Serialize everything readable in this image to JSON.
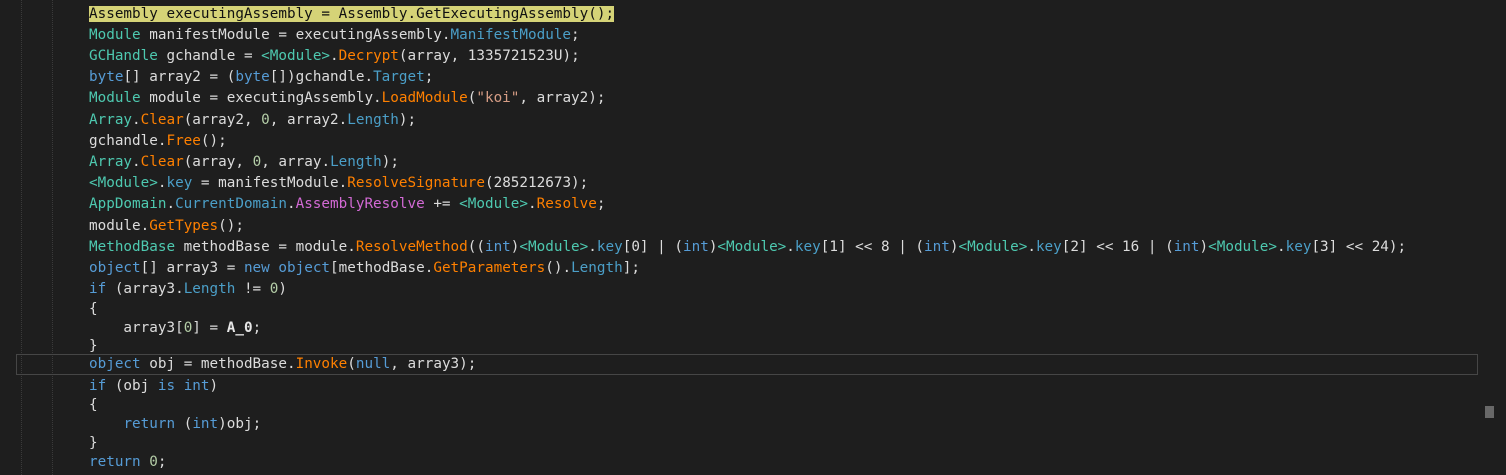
{
  "code": {
    "lines": [
      [
        {
          "t": "Assembly executingAssembly = Assembly.GetExecutingAssembly();",
          "c": "hl"
        }
      ],
      [
        {
          "t": "Module",
          "c": "ty"
        },
        {
          "t": " manifestModule = executingAssembly."
        },
        {
          "t": "ManifestModule",
          "c": "pr"
        },
        {
          "t": ";"
        }
      ],
      [
        {
          "t": "GCHandle",
          "c": "ty"
        },
        {
          "t": " gchandle = "
        },
        {
          "t": "<Module>",
          "c": "ty"
        },
        {
          "t": "."
        },
        {
          "t": "Decrypt",
          "c": "me"
        },
        {
          "t": "(array, 1335721523U);"
        }
      ],
      [
        {
          "t": "byte",
          "c": "kw"
        },
        {
          "t": "[] array2 = ("
        },
        {
          "t": "byte",
          "c": "kw"
        },
        {
          "t": "[])gchandle."
        },
        {
          "t": "Target",
          "c": "pr"
        },
        {
          "t": ";"
        }
      ],
      [
        {
          "t": "Module",
          "c": "ty"
        },
        {
          "t": " module = executingAssembly."
        },
        {
          "t": "LoadModule",
          "c": "me"
        },
        {
          "t": "("
        },
        {
          "t": "\"koi\"",
          "c": "st"
        },
        {
          "t": ", array2);"
        }
      ],
      [
        {
          "t": "Array",
          "c": "ty"
        },
        {
          "t": "."
        },
        {
          "t": "Clear",
          "c": "me"
        },
        {
          "t": "(array2, "
        },
        {
          "t": "0",
          "c": "nu"
        },
        {
          "t": ", array2."
        },
        {
          "t": "Length",
          "c": "pr"
        },
        {
          "t": ");"
        }
      ],
      [
        {
          "t": "gchandle."
        },
        {
          "t": "Free",
          "c": "me"
        },
        {
          "t": "();"
        }
      ],
      [
        {
          "t": "Array",
          "c": "ty"
        },
        {
          "t": "."
        },
        {
          "t": "Clear",
          "c": "me"
        },
        {
          "t": "(array, "
        },
        {
          "t": "0",
          "c": "nu"
        },
        {
          "t": ", array."
        },
        {
          "t": "Length",
          "c": "pr"
        },
        {
          "t": ");"
        }
      ],
      [
        {
          "t": "<Module>",
          "c": "ty"
        },
        {
          "t": "."
        },
        {
          "t": "key",
          "c": "pr"
        },
        {
          "t": " = manifestModule."
        },
        {
          "t": "ResolveSignature",
          "c": "me"
        },
        {
          "t": "(285212673);"
        }
      ],
      [
        {
          "t": "AppDomain",
          "c": "ty"
        },
        {
          "t": "."
        },
        {
          "t": "CurrentDomain",
          "c": "pr"
        },
        {
          "t": "."
        },
        {
          "t": "AssemblyResolve",
          "c": "ev"
        },
        {
          "t": " += "
        },
        {
          "t": "<Module>",
          "c": "ty"
        },
        {
          "t": "."
        },
        {
          "t": "Resolve",
          "c": "me"
        },
        {
          "t": ";"
        }
      ],
      [
        {
          "t": "module."
        },
        {
          "t": "GetTypes",
          "c": "me"
        },
        {
          "t": "();"
        }
      ],
      [
        {
          "t": "MethodBase",
          "c": "ty"
        },
        {
          "t": " methodBase = module."
        },
        {
          "t": "ResolveMethod",
          "c": "me"
        },
        {
          "t": "(("
        },
        {
          "t": "int",
          "c": "kw"
        },
        {
          "t": ")"
        },
        {
          "t": "<Module>",
          "c": "ty"
        },
        {
          "t": "."
        },
        {
          "t": "key",
          "c": "pr"
        },
        {
          "t": "[0] | ("
        },
        {
          "t": "int",
          "c": "kw"
        },
        {
          "t": ")"
        },
        {
          "t": "<Module>",
          "c": "ty"
        },
        {
          "t": "."
        },
        {
          "t": "key",
          "c": "pr"
        },
        {
          "t": "[1] << 8 | ("
        },
        {
          "t": "int",
          "c": "kw"
        },
        {
          "t": ")"
        },
        {
          "t": "<Module>",
          "c": "ty"
        },
        {
          "t": "."
        },
        {
          "t": "key",
          "c": "pr"
        },
        {
          "t": "[2] << 16 | ("
        },
        {
          "t": "int",
          "c": "kw"
        },
        {
          "t": ")"
        },
        {
          "t": "<Module>",
          "c": "ty"
        },
        {
          "t": "."
        },
        {
          "t": "key",
          "c": "pr"
        },
        {
          "t": "[3] << 24);"
        }
      ],
      [
        {
          "t": "object",
          "c": "kw"
        },
        {
          "t": "[] array3 = "
        },
        {
          "t": "new",
          "c": "kw"
        },
        {
          "t": " "
        },
        {
          "t": "object",
          "c": "kw"
        },
        {
          "t": "[methodBase."
        },
        {
          "t": "GetParameters",
          "c": "me"
        },
        {
          "t": "()."
        },
        {
          "t": "Length",
          "c": "pr"
        },
        {
          "t": "];"
        }
      ],
      [
        {
          "t": "if",
          "c": "kw"
        },
        {
          "t": " (array3."
        },
        {
          "t": "Length",
          "c": "pr"
        },
        {
          "t": " != "
        },
        {
          "t": "0",
          "c": "nu"
        },
        {
          "t": ")"
        }
      ],
      [
        {
          "t": "{"
        }
      ],
      [
        {
          "t": "    array3["
        },
        {
          "t": "0",
          "c": "nu"
        },
        {
          "t": "] = "
        },
        {
          "t": "A_0",
          "c": "pa"
        },
        {
          "t": ";"
        }
      ],
      [
        {
          "t": "}"
        }
      ],
      [
        {
          "t": "object",
          "c": "kw"
        },
        {
          "t": " obj = methodBase."
        },
        {
          "t": "Invoke",
          "c": "me"
        },
        {
          "t": "("
        },
        {
          "t": "null",
          "c": "kw"
        },
        {
          "t": ", array3);"
        }
      ],
      [
        {
          "t": "if",
          "c": "kw"
        },
        {
          "t": " (obj "
        },
        {
          "t": "is",
          "c": "kw"
        },
        {
          "t": " "
        },
        {
          "t": "int",
          "c": "kw"
        },
        {
          "t": ")"
        }
      ],
      [
        {
          "t": "{"
        }
      ],
      [
        {
          "t": "    "
        },
        {
          "t": "return",
          "c": "kw"
        },
        {
          "t": " ("
        },
        {
          "t": "int",
          "c": "kw"
        },
        {
          "t": ")obj;"
        }
      ],
      [
        {
          "t": "}"
        }
      ],
      [
        {
          "t": "return",
          "c": "kw"
        },
        {
          "t": " "
        },
        {
          "t": "0",
          "c": "nu"
        },
        {
          "t": ";"
        }
      ]
    ]
  }
}
